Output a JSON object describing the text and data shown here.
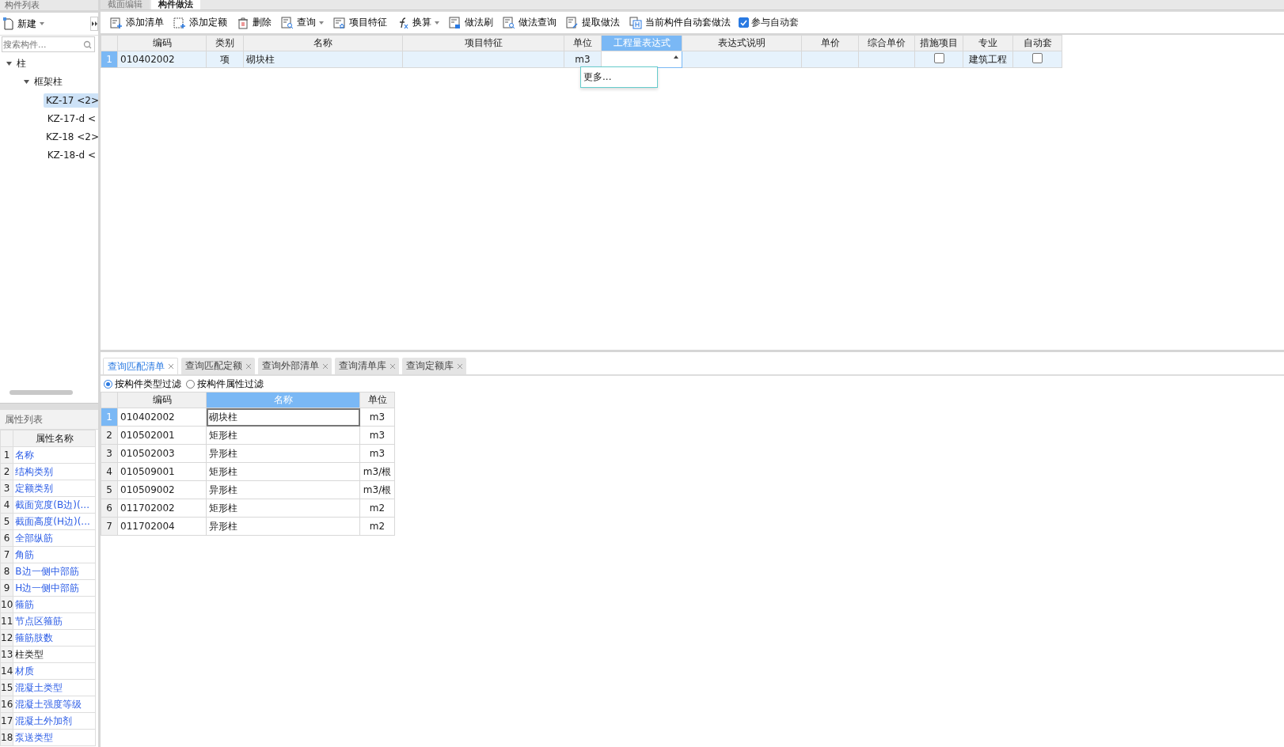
{
  "left_panel": {
    "title": "构件列表",
    "new_button": {
      "label": "新建",
      "dropdown": true
    },
    "search": {
      "placeholder": "搜索构件..."
    },
    "tree": [
      {
        "label": "柱",
        "expanded": true,
        "selected": false,
        "children": [
          {
            "label": "框架柱",
            "expanded": true,
            "selected": false,
            "children": [
              {
                "label": "KZ-17 <2>",
                "selected": true
              },
              {
                "label": "KZ-17-d <",
                "selected": false
              },
              {
                "label": "KZ-18 <2>",
                "selected": false
              },
              {
                "label": "KZ-18-d <",
                "selected": false
              }
            ]
          }
        ]
      }
    ]
  },
  "property_list": {
    "title": "属性列表",
    "column": "属性名称",
    "rows": [
      {
        "num": "1",
        "name": "名称",
        "linked": true
      },
      {
        "num": "2",
        "name": "结构类别",
        "linked": true
      },
      {
        "num": "3",
        "name": "定额类别",
        "linked": true
      },
      {
        "num": "4",
        "name": "截面宽度(B边)(...",
        "linked": true
      },
      {
        "num": "5",
        "name": "截面高度(H边)(...",
        "linked": true
      },
      {
        "num": "6",
        "name": "全部纵筋",
        "linked": true
      },
      {
        "num": "7",
        "name": "角筋",
        "linked": true
      },
      {
        "num": "8",
        "name": "B边一侧中部筋",
        "linked": true
      },
      {
        "num": "9",
        "name": "H边一侧中部筋",
        "linked": true
      },
      {
        "num": "10",
        "name": "箍筋",
        "linked": true
      },
      {
        "num": "11",
        "name": "节点区箍筋",
        "linked": true
      },
      {
        "num": "12",
        "name": "箍筋肢数",
        "linked": true
      },
      {
        "num": "13",
        "name": "柱类型",
        "linked": false
      },
      {
        "num": "14",
        "name": "材质",
        "linked": true
      },
      {
        "num": "15",
        "name": "混凝土类型",
        "linked": true
      },
      {
        "num": "16",
        "name": "混凝土强度等级",
        "linked": true
      },
      {
        "num": "17",
        "name": "混凝土外加剂",
        "linked": true
      },
      {
        "num": "18",
        "name": "泵送类型",
        "linked": true
      }
    ]
  },
  "top_tabs": [
    {
      "label": "截面编辑",
      "selected": false
    },
    {
      "label": "构件做法",
      "selected": true
    }
  ],
  "toolbar": [
    {
      "kind": "add-list",
      "label": "添加清单",
      "dropdown": false
    },
    {
      "kind": "add-quota",
      "label": "添加定额",
      "dropdown": false
    },
    {
      "kind": "delete",
      "label": "删除",
      "dropdown": false
    },
    {
      "kind": "query",
      "label": "查询",
      "dropdown": true
    },
    {
      "kind": "feature",
      "label": "项目特征",
      "dropdown": false
    },
    {
      "kind": "formula",
      "label": "换算",
      "dropdown": true
    },
    {
      "kind": "brush",
      "label": "做法刷",
      "dropdown": false
    },
    {
      "kind": "query",
      "label": "做法查询",
      "dropdown": false
    },
    {
      "kind": "extract",
      "label": "提取做法",
      "dropdown": false
    },
    {
      "kind": "auto",
      "label": "当前构件自动套做法",
      "dropdown": false
    },
    {
      "kind": "checkbox",
      "label": "参与自动套",
      "checked": true
    }
  ],
  "method_table": {
    "columns": [
      {
        "label": "编码",
        "selected": false
      },
      {
        "label": "类别",
        "selected": false
      },
      {
        "label": "名称",
        "selected": false
      },
      {
        "label": "项目特征",
        "selected": false
      },
      {
        "label": "单位",
        "selected": false
      },
      {
        "label": "工程量表达式",
        "selected": true
      },
      {
        "label": "表达式说明",
        "selected": false
      },
      {
        "label": "单价",
        "selected": false
      },
      {
        "label": "综合单价",
        "selected": false
      },
      {
        "label": "措施项目",
        "selected": false
      },
      {
        "label": "专业",
        "selected": false
      },
      {
        "label": "自动套",
        "selected": false
      }
    ],
    "rows": [
      {
        "num": "1",
        "selected": true,
        "code": "010402002",
        "category": "项",
        "name": "砌块柱",
        "features": "",
        "unit": "m3",
        "measure_item": false,
        "discipline": "建筑工程",
        "auto_apply": false
      }
    ],
    "dropdown_menu": [
      "更多..."
    ]
  },
  "query_tabs": [
    {
      "label": "查询匹配清单",
      "selected": true
    },
    {
      "label": "查询匹配定额",
      "selected": false
    },
    {
      "label": "查询外部清单",
      "selected": false
    },
    {
      "label": "查询清单库",
      "selected": false
    },
    {
      "label": "查询定额库",
      "selected": false
    }
  ],
  "filters": [
    {
      "label": "按构件类型过滤",
      "selected": true
    },
    {
      "label": "按构件属性过滤",
      "selected": false
    }
  ],
  "query_table": {
    "columns": [
      {
        "label": "编码",
        "selected": false
      },
      {
        "label": "名称",
        "selected": true
      },
      {
        "label": "单位",
        "selected": false
      }
    ],
    "rows": [
      {
        "num": "1",
        "code": "010402002",
        "name": "砌块柱",
        "unit": "m3",
        "selected": true
      },
      {
        "num": "2",
        "code": "010502001",
        "name": "矩形柱",
        "unit": "m3",
        "selected": false
      },
      {
        "num": "3",
        "code": "010502003",
        "name": "异形柱",
        "unit": "m3",
        "selected": false
      },
      {
        "num": "4",
        "code": "010509001",
        "name": "矩形柱",
        "unit": "m3/根",
        "selected": false
      },
      {
        "num": "5",
        "code": "010509002",
        "name": "异形柱",
        "unit": "m3/根",
        "selected": false
      },
      {
        "num": "6",
        "code": "011702002",
        "name": "矩形柱",
        "unit": "m2",
        "selected": false
      },
      {
        "num": "7",
        "code": "011702004",
        "name": "异形柱",
        "unit": "m2",
        "selected": false
      }
    ]
  }
}
